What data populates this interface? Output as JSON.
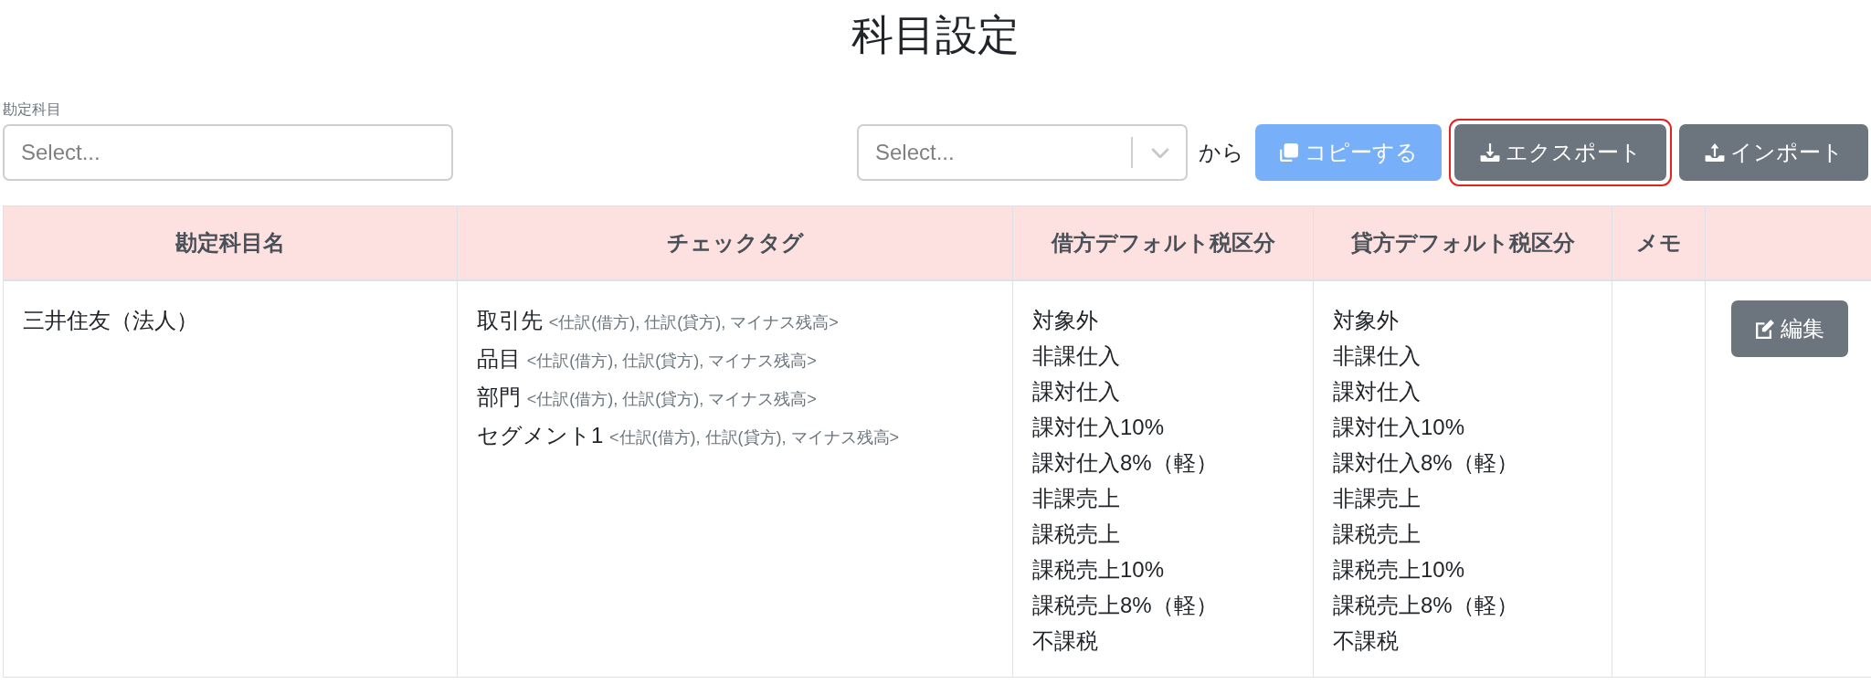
{
  "page": {
    "title": "科目設定"
  },
  "filter": {
    "label": "勘定科目",
    "placeholder": "Select..."
  },
  "copy_controls": {
    "source_select": {
      "placeholder": "Select..."
    },
    "from_text": "から",
    "buttons": [
      {
        "kind": "copy",
        "label": "コピーする",
        "disabled": true,
        "focused": false
      },
      {
        "kind": "export",
        "label": "エクスポート",
        "disabled": false,
        "focused": true
      },
      {
        "kind": "import",
        "label": "インポート",
        "disabled": false,
        "focused": false
      }
    ]
  },
  "table": {
    "columns": [
      "勘定科目名",
      "チェックタグ",
      "借方デフォルト税区分",
      "貸方デフォルト税区分",
      "メモ"
    ],
    "rows": [
      {
        "account": "三井住友（法人）",
        "check_tags": [
          {
            "name": "取引先",
            "targets": "<仕訳(借方), 仕訳(貸方), マイナス残高>"
          },
          {
            "name": "品目",
            "targets": "<仕訳(借方), 仕訳(貸方), マイナス残高>"
          },
          {
            "name": "部門",
            "targets": "<仕訳(借方), 仕訳(貸方), マイナス残高>"
          },
          {
            "name": "セグメント1",
            "targets": "<仕訳(借方), 仕訳(貸方), マイナス残高>"
          }
        ],
        "debit_tax": [
          "対象外",
          "非課仕入",
          "課対仕入",
          "課対仕入10%",
          "課対仕入8%（軽）",
          "非課売上",
          "課税売上",
          "課税売上10%",
          "課税売上8%（軽）",
          "不課税"
        ],
        "credit_tax": [
          "対象外",
          "非課仕入",
          "課対仕入",
          "課対仕入10%",
          "課対仕入8%（軽）",
          "非課売上",
          "課税売上",
          "課税売上10%",
          "課税売上8%（軽）",
          "不課税"
        ],
        "edit_label": "編集"
      }
    ]
  }
}
